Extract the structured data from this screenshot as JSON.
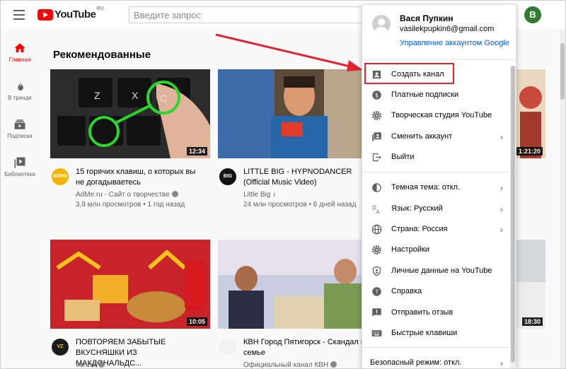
{
  "header": {
    "logo_text": "YouTube",
    "logo_region": "RU",
    "search_placeholder": "Введите запрос",
    "avatar_letter": "В"
  },
  "sidebar": {
    "items": [
      {
        "label": "Главная",
        "icon": "home-icon",
        "active": true
      },
      {
        "label": "В тренде",
        "icon": "fire-icon"
      },
      {
        "label": "Подписки",
        "icon": "subscriptions-icon"
      },
      {
        "label": "Библиотека",
        "icon": "library-icon"
      }
    ]
  },
  "main": {
    "section_title": "Рекомендованные",
    "videos": [
      {
        "title_line1": "15 горячих клавиш, о которых вы",
        "title_line2": "не догадываетесь",
        "channel": "AdMe.ru - Сайт о творчестве",
        "meta": "3,9 млн просмотров • 1 год назад",
        "duration": "12:34",
        "avatar": "ADME"
      },
      {
        "title_line1": "LITTLE BIG - HYPNODANCER",
        "title_line2": "(Official Music Video)",
        "channel": "Little Big",
        "meta": "24 млн просмотров • 6 дней назад",
        "duration": "",
        "avatar": "BIG"
      },
      {
        "title_line1": "",
        "title_line2": "",
        "channel": "",
        "meta": "",
        "duration": "1:21:20",
        "avatar": ""
      },
      {
        "title_line1": "ПОВТОРЯЕМ ЗАБЫТЫЕ",
        "title_line2": "ВКУСНЯШКИ ИЗ МАКДОНАЛЬДС...",
        "channel": "vanzai",
        "meta": "",
        "duration": "10:05",
        "avatar": "VZ"
      },
      {
        "title_line1": "КВН Город Пятигорск - Скандал в",
        "title_line2": "семье",
        "channel": "Официальный канал КВН",
        "meta": "",
        "duration": "",
        "avatar": ""
      },
      {
        "title_line1": "",
        "title_line2": "",
        "channel": "",
        "meta": "",
        "duration": "18:30",
        "avatar": ""
      }
    ]
  },
  "account_menu": {
    "name": "Вася Пупкин",
    "email": "vasilekpupkin6@gmail.com",
    "manage_link": "Управление аккаунтом Google",
    "items": [
      {
        "label": "Создать канал",
        "icon": "create-channel-icon",
        "chevron": false
      },
      {
        "label": "Платные подписки",
        "icon": "paid-subscriptions-icon",
        "chevron": false
      },
      {
        "label": "Творческая студия YouTube",
        "icon": "gear-icon",
        "chevron": false
      },
      {
        "label": "Сменить аккаунт",
        "icon": "switch-account-icon",
        "chevron": true
      },
      {
        "label": "Выйти",
        "icon": "sign-out-icon",
        "chevron": false
      },
      {
        "label": "Темная тема: откл.",
        "icon": "dark-theme-icon",
        "chevron": true
      },
      {
        "label": "Язык: Русский",
        "icon": "language-icon",
        "chevron": true
      },
      {
        "label": "Страна: Россия",
        "icon": "globe-icon",
        "chevron": true
      },
      {
        "label": "Настройки",
        "icon": "settings-icon",
        "chevron": false
      },
      {
        "label": "Личные данные на YouTube",
        "icon": "personal-data-icon",
        "chevron": false
      },
      {
        "label": "Справка",
        "icon": "help-icon",
        "chevron": false
      },
      {
        "label": "Отправить отзыв",
        "icon": "feedback-icon",
        "chevron": false
      },
      {
        "label": "Быстрые клавиши",
        "icon": "keyboard-icon",
        "chevron": false
      },
      {
        "label": "Безопасный режим: откл.",
        "icon": "",
        "chevron": true
      }
    ],
    "chevron": "›"
  },
  "colors": {
    "accent_red": "#ff0000",
    "highlight": "#e3222f",
    "link_blue": "#065fd4"
  }
}
